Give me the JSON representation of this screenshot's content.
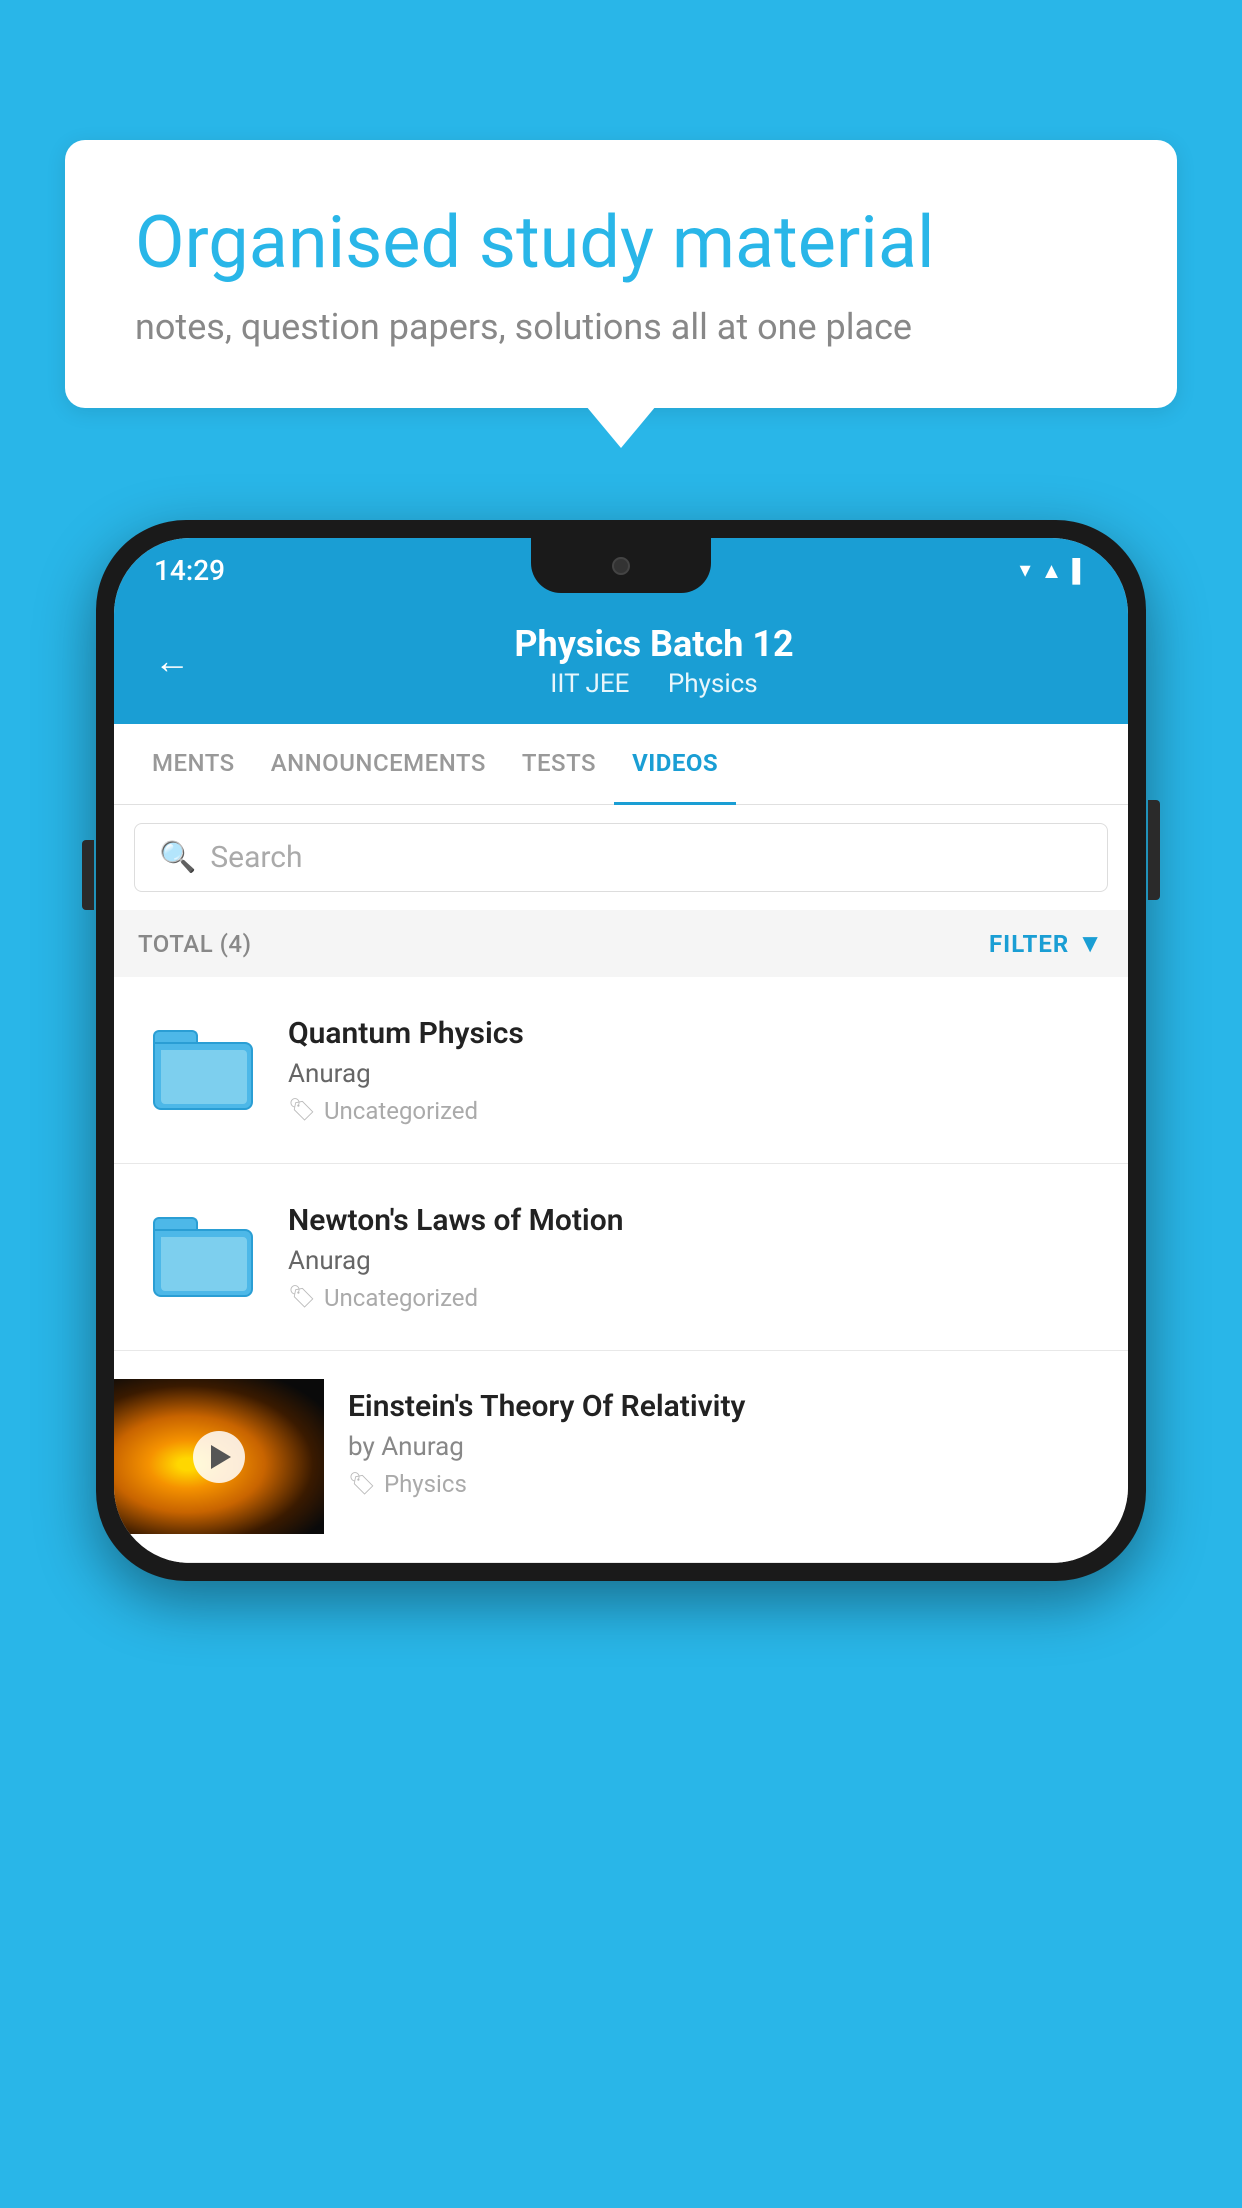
{
  "background_color": "#29b6e8",
  "speech_bubble": {
    "headline": "Organised study material",
    "subtext": "notes, question papers, solutions all at one place"
  },
  "phone": {
    "status_bar": {
      "time": "14:29"
    },
    "header": {
      "title": "Physics Batch 12",
      "subtitle_part1": "IIT JEE",
      "subtitle_part2": "Physics",
      "back_label": "←"
    },
    "tabs": [
      {
        "label": "MENTS",
        "active": false
      },
      {
        "label": "ANNOUNCEMENTS",
        "active": false
      },
      {
        "label": "TESTS",
        "active": false
      },
      {
        "label": "VIDEOS",
        "active": true
      }
    ],
    "search": {
      "placeholder": "Search"
    },
    "filter": {
      "total_label": "TOTAL (4)",
      "filter_label": "FILTER"
    },
    "videos": [
      {
        "title": "Quantum Physics",
        "author": "Anurag",
        "tag": "Uncategorized",
        "type": "folder",
        "has_thumb": false
      },
      {
        "title": "Newton's Laws of Motion",
        "author": "Anurag",
        "tag": "Uncategorized",
        "type": "folder",
        "has_thumb": false
      },
      {
        "title": "Einstein's Theory Of Relativity",
        "author": "by Anurag",
        "tag": "Physics",
        "type": "video",
        "has_thumb": true
      }
    ]
  }
}
